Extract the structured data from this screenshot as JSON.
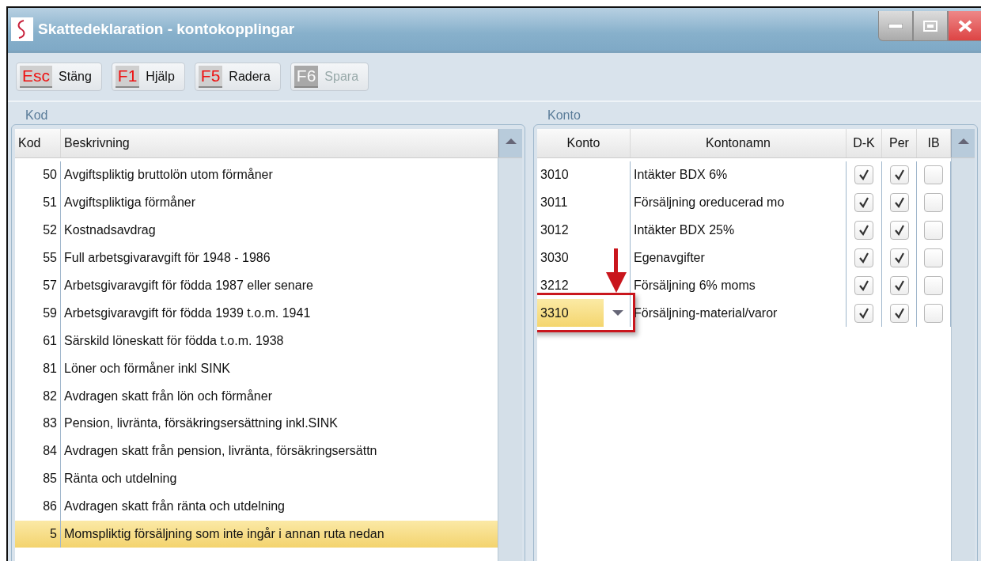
{
  "window": {
    "title": "Skattedeklaration - kontokopplingar"
  },
  "toolbar": [
    {
      "key": "Esc",
      "label": "Stäng",
      "disabled": false
    },
    {
      "key": "F1",
      "label": "Hjälp",
      "disabled": false
    },
    {
      "key": "F5",
      "label": "Radera",
      "disabled": false
    },
    {
      "key": "F6",
      "label": "Spara",
      "disabled": true
    }
  ],
  "kod_panel": {
    "title": "Kod",
    "columns": [
      "Kod",
      "Beskrivning"
    ],
    "rows": [
      {
        "kod": "50",
        "beskrivning": "Avgiftspliktig bruttolön utom förmåner",
        "selected": false
      },
      {
        "kod": "51",
        "beskrivning": "Avgiftspliktiga förmåner",
        "selected": false
      },
      {
        "kod": "52",
        "beskrivning": "Kostnadsavdrag",
        "selected": false
      },
      {
        "kod": "55",
        "beskrivning": "Full arbetsgivaravgift för 1948 - 1986",
        "selected": false
      },
      {
        "kod": "57",
        "beskrivning": "Arbetsgivaravgift för födda 1987 eller senare",
        "selected": false
      },
      {
        "kod": "59",
        "beskrivning": "Arbetsgivaravgift för födda 1939 t.o.m. 1941",
        "selected": false
      },
      {
        "kod": "61",
        "beskrivning": "Särskild löneskatt för födda t.o.m. 1938",
        "selected": false
      },
      {
        "kod": "81",
        "beskrivning": "Löner och förmåner inkl SINK",
        "selected": false
      },
      {
        "kod": "82",
        "beskrivning": "Avdragen skatt från lön och förmåner",
        "selected": false
      },
      {
        "kod": "83",
        "beskrivning": "Pension, livränta, försäkringsersättning inkl.SINK",
        "selected": false
      },
      {
        "kod": "84",
        "beskrivning": "Avdragen skatt från pension, livränta, försäkringsersättn",
        "selected": false
      },
      {
        "kod": "85",
        "beskrivning": "Ränta och utdelning",
        "selected": false
      },
      {
        "kod": "86",
        "beskrivning": "Avdragen skatt från ränta och utdelning",
        "selected": false
      },
      {
        "kod": "5",
        "beskrivning": "Momspliktig försäljning som inte ingår i annan ruta nedan",
        "selected": true
      }
    ]
  },
  "konto_panel": {
    "title": "Konto",
    "columns": [
      "Konto",
      "Kontonamn",
      "D-K",
      "Per",
      "IB"
    ],
    "rows": [
      {
        "konto": "3010",
        "kontonamn": "Intäkter BDX 6%",
        "dk": true,
        "per": true,
        "ib": false,
        "editing": false
      },
      {
        "konto": "3011",
        "kontonamn": "Försäljning oreducerad mo",
        "dk": true,
        "per": true,
        "ib": false,
        "editing": false
      },
      {
        "konto": "3012",
        "kontonamn": "Intäkter BDX 25%",
        "dk": true,
        "per": true,
        "ib": false,
        "editing": false
      },
      {
        "konto": "3030",
        "kontonamn": "Egenavgifter",
        "dk": true,
        "per": true,
        "ib": false,
        "editing": false
      },
      {
        "konto": "3212",
        "kontonamn": "Försäljning 6% moms",
        "dk": true,
        "per": true,
        "ib": false,
        "editing": false
      },
      {
        "konto": "3310",
        "kontonamn": "Försäljning-material/varor",
        "dk": true,
        "per": true,
        "ib": false,
        "editing": true
      }
    ]
  }
}
